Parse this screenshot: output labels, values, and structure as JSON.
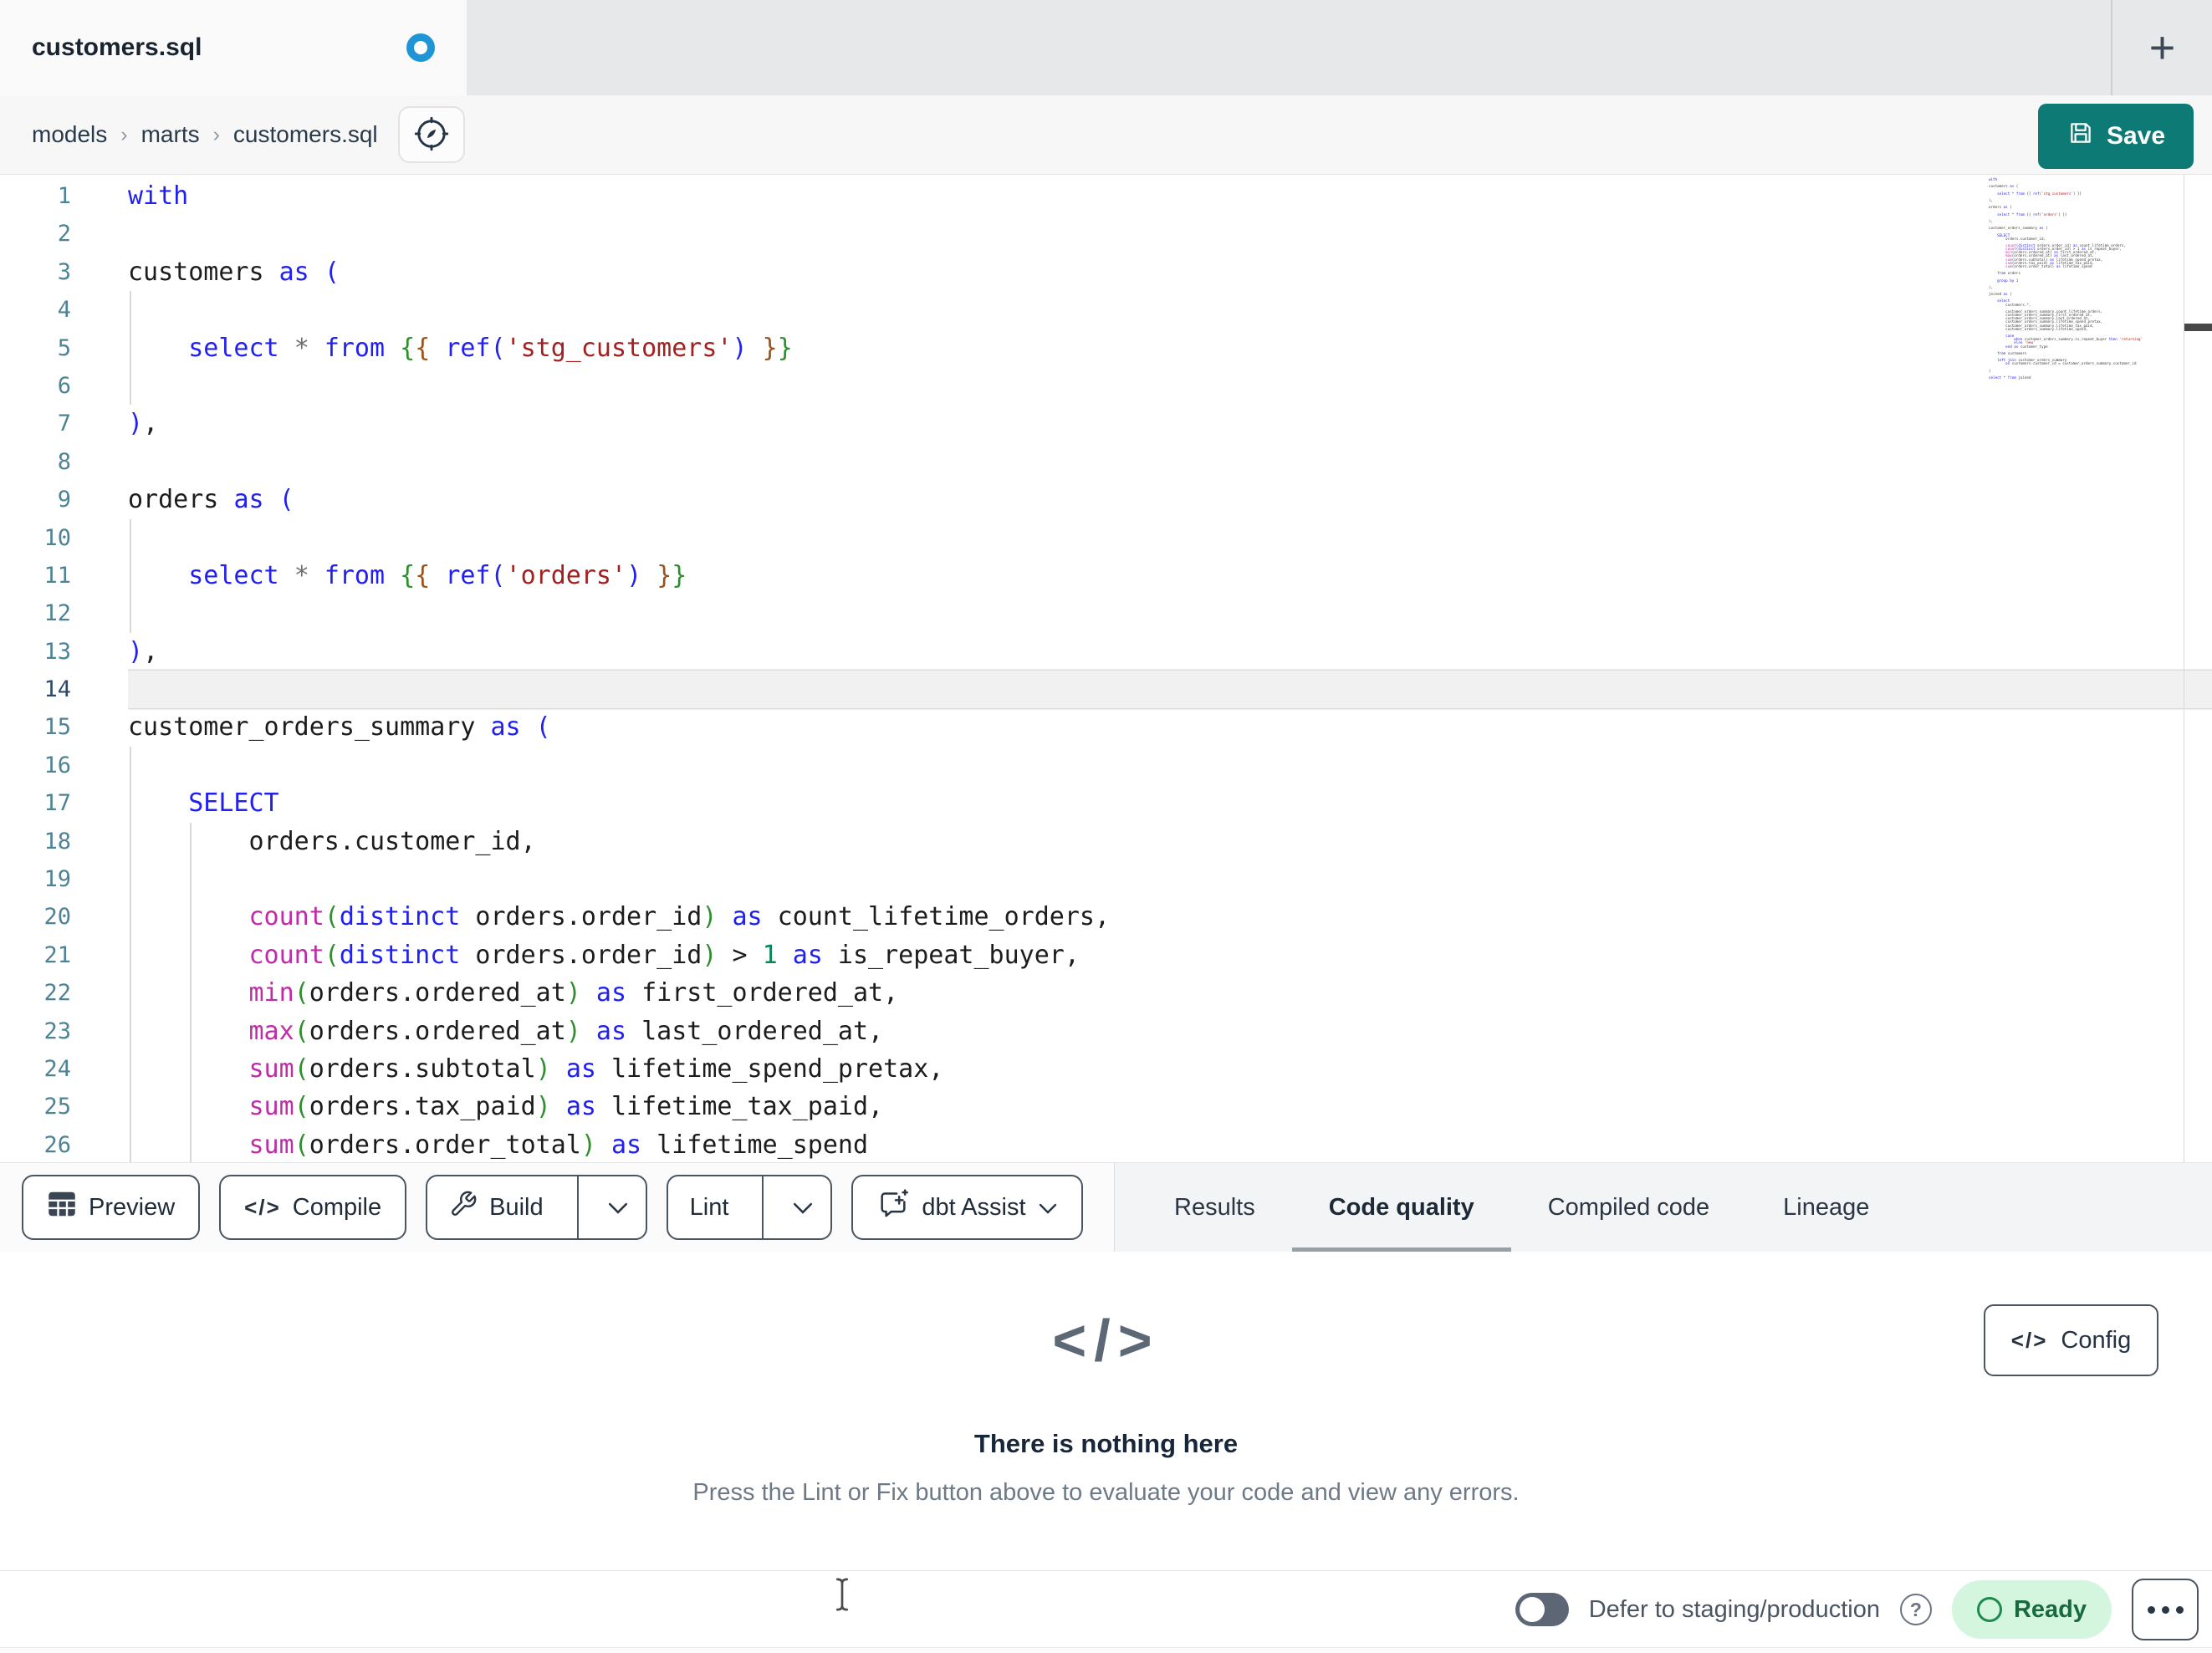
{
  "tab_bar": {
    "active_tab": "customers.sql",
    "new_tab_label": "+"
  },
  "breadcrumb": {
    "items": [
      "models",
      "marts",
      "customers.sql"
    ],
    "separator": "›"
  },
  "save": {
    "label": "Save"
  },
  "toolbar": {
    "preview": "Preview",
    "compile": "Compile",
    "build": "Build",
    "lint": "Lint",
    "dbt_assist": "dbt Assist",
    "compile_icon": "</>"
  },
  "result_tabs": [
    {
      "label": "Results",
      "active": false
    },
    {
      "label": "Code quality",
      "active": true
    },
    {
      "label": "Compiled code",
      "active": false
    },
    {
      "label": "Lineage",
      "active": false
    }
  ],
  "panel": {
    "empty_icon": "</>",
    "title": "There is nothing here",
    "description": "Press the Lint or Fix button above to evaluate your code and view any errors.",
    "config_label": "Config",
    "config_icon": "</>"
  },
  "footer": {
    "defer_label": "Defer to staging/production",
    "help_glyph": "?",
    "status": "Ready"
  },
  "colors": {
    "save_button": "#0e7a76",
    "modified_dot": "#2095d6",
    "ready_badge_bg": "#d5f6de",
    "ready_badge_text": "#186a3e",
    "keyword_blue": "#2121ef",
    "function_magenta": "#c02ca8",
    "string_red": "#a32020",
    "number_green": "#0a8658"
  },
  "editor": {
    "lines": [
      {
        "n": 1,
        "g": [],
        "a": false,
        "t": [
          [
            "kw",
            "with"
          ]
        ]
      },
      {
        "n": 2,
        "g": [],
        "a": false,
        "t": []
      },
      {
        "n": 3,
        "g": [],
        "a": false,
        "t": [
          [
            "pl",
            "customers "
          ],
          [
            "kw",
            "as"
          ],
          [
            "pl",
            " "
          ],
          [
            "pb",
            "("
          ]
        ]
      },
      {
        "n": 4,
        "g": [
          0
        ],
        "a": false,
        "t": []
      },
      {
        "n": 5,
        "g": [
          0
        ],
        "a": false,
        "t": [
          [
            "pl",
            "    "
          ],
          [
            "kw",
            "select"
          ],
          [
            "pl",
            " "
          ],
          [
            "op",
            "*"
          ],
          [
            "pl",
            " "
          ],
          [
            "kw",
            "from"
          ],
          [
            "pl",
            " "
          ],
          [
            "jo",
            "{"
          ],
          [
            "ji",
            "{"
          ],
          [
            "pl",
            " "
          ],
          [
            "kw",
            "ref"
          ],
          [
            "pb",
            "("
          ],
          [
            "str",
            "'stg_customers'"
          ],
          [
            "pb",
            ")"
          ],
          [
            "pl",
            " "
          ],
          [
            "ji",
            "}"
          ],
          [
            "jo",
            "}"
          ]
        ]
      },
      {
        "n": 6,
        "g": [
          0
        ],
        "a": false,
        "t": []
      },
      {
        "n": 7,
        "g": [],
        "a": false,
        "t": [
          [
            "pb",
            ")"
          ],
          [
            "pl",
            ","
          ]
        ]
      },
      {
        "n": 8,
        "g": [],
        "a": false,
        "t": []
      },
      {
        "n": 9,
        "g": [],
        "a": false,
        "t": [
          [
            "pl",
            "orders "
          ],
          [
            "kw",
            "as"
          ],
          [
            "pl",
            " "
          ],
          [
            "pb",
            "("
          ]
        ]
      },
      {
        "n": 10,
        "g": [
          0
        ],
        "a": false,
        "t": []
      },
      {
        "n": 11,
        "g": [
          0
        ],
        "a": false,
        "t": [
          [
            "pl",
            "    "
          ],
          [
            "kw",
            "select"
          ],
          [
            "pl",
            " "
          ],
          [
            "op",
            "*"
          ],
          [
            "pl",
            " "
          ],
          [
            "kw",
            "from"
          ],
          [
            "pl",
            " "
          ],
          [
            "jo",
            "{"
          ],
          [
            "ji",
            "{"
          ],
          [
            "pl",
            " "
          ],
          [
            "kw",
            "ref"
          ],
          [
            "pb",
            "("
          ],
          [
            "str",
            "'orders'"
          ],
          [
            "pb",
            ")"
          ],
          [
            "pl",
            " "
          ],
          [
            "ji",
            "}"
          ],
          [
            "jo",
            "}"
          ]
        ]
      },
      {
        "n": 12,
        "g": [
          0
        ],
        "a": false,
        "t": []
      },
      {
        "n": 13,
        "g": [],
        "a": false,
        "t": [
          [
            "pb",
            ")"
          ],
          [
            "pl",
            ","
          ]
        ]
      },
      {
        "n": 14,
        "g": [],
        "a": true,
        "t": []
      },
      {
        "n": 15,
        "g": [],
        "a": false,
        "t": [
          [
            "pl",
            "customer_orders_summary "
          ],
          [
            "kw",
            "as"
          ],
          [
            "pl",
            " "
          ],
          [
            "pb",
            "("
          ]
        ]
      },
      {
        "n": 16,
        "g": [
          0
        ],
        "a": false,
        "t": []
      },
      {
        "n": 17,
        "g": [
          0
        ],
        "a": false,
        "t": [
          [
            "pl",
            "    "
          ],
          [
            "kw",
            "SELECT"
          ]
        ]
      },
      {
        "n": 18,
        "g": [
          0,
          1
        ],
        "a": false,
        "t": [
          [
            "pl",
            "        orders.customer_id,"
          ]
        ]
      },
      {
        "n": 19,
        "g": [
          0,
          1
        ],
        "a": false,
        "t": []
      },
      {
        "n": 20,
        "g": [
          0,
          1
        ],
        "a": false,
        "t": [
          [
            "pl",
            "        "
          ],
          [
            "fn",
            "count"
          ],
          [
            "pg",
            "("
          ],
          [
            "kw",
            "distinct"
          ],
          [
            "pl",
            " orders.order_id"
          ],
          [
            "pg",
            ")"
          ],
          [
            "pl",
            " "
          ],
          [
            "kw",
            "as"
          ],
          [
            "pl",
            " count_lifetime_orders,"
          ]
        ]
      },
      {
        "n": 21,
        "g": [
          0,
          1
        ],
        "a": false,
        "t": [
          [
            "pl",
            "        "
          ],
          [
            "fn",
            "count"
          ],
          [
            "pg",
            "("
          ],
          [
            "kw",
            "distinct"
          ],
          [
            "pl",
            " orders.order_id"
          ],
          [
            "pg",
            ")"
          ],
          [
            "pl",
            " > "
          ],
          [
            "num",
            "1"
          ],
          [
            "pl",
            " "
          ],
          [
            "kw",
            "as"
          ],
          [
            "pl",
            " is_repeat_buyer,"
          ]
        ]
      },
      {
        "n": 22,
        "g": [
          0,
          1
        ],
        "a": false,
        "t": [
          [
            "pl",
            "        "
          ],
          [
            "fn",
            "min"
          ],
          [
            "pg",
            "("
          ],
          [
            "pl",
            "orders.ordered_at"
          ],
          [
            "pg",
            ")"
          ],
          [
            "pl",
            " "
          ],
          [
            "kw",
            "as"
          ],
          [
            "pl",
            " first_ordered_at,"
          ]
        ]
      },
      {
        "n": 23,
        "g": [
          0,
          1
        ],
        "a": false,
        "t": [
          [
            "pl",
            "        "
          ],
          [
            "fn",
            "max"
          ],
          [
            "pg",
            "("
          ],
          [
            "pl",
            "orders.ordered_at"
          ],
          [
            "pg",
            ")"
          ],
          [
            "pl",
            " "
          ],
          [
            "kw",
            "as"
          ],
          [
            "pl",
            " last_ordered_at,"
          ]
        ]
      },
      {
        "n": 24,
        "g": [
          0,
          1
        ],
        "a": false,
        "t": [
          [
            "pl",
            "        "
          ],
          [
            "fn",
            "sum"
          ],
          [
            "pg",
            "("
          ],
          [
            "pl",
            "orders.subtotal"
          ],
          [
            "pg",
            ")"
          ],
          [
            "pl",
            " "
          ],
          [
            "kw",
            "as"
          ],
          [
            "pl",
            " lifetime_spend_pretax,"
          ]
        ]
      },
      {
        "n": 25,
        "g": [
          0,
          1
        ],
        "a": false,
        "t": [
          [
            "pl",
            "        "
          ],
          [
            "fn",
            "sum"
          ],
          [
            "pg",
            "("
          ],
          [
            "pl",
            "orders.tax_paid"
          ],
          [
            "pg",
            ")"
          ],
          [
            "pl",
            " "
          ],
          [
            "kw",
            "as"
          ],
          [
            "pl",
            " lifetime_tax_paid,"
          ]
        ]
      },
      {
        "n": 26,
        "g": [
          0,
          1
        ],
        "a": false,
        "t": [
          [
            "pl",
            "        "
          ],
          [
            "fn",
            "sum"
          ],
          [
            "pg",
            "("
          ],
          [
            "pl",
            "orders.order_total"
          ],
          [
            "pg",
            ")"
          ],
          [
            "pl",
            " "
          ],
          [
            "kw",
            "as"
          ],
          [
            "pl",
            " lifetime_spend"
          ]
        ]
      }
    ],
    "minimap_lines": [
      "with",
      "",
      "customers as (",
      "",
      "    select * from {{ ref('stg_customers') }}",
      "",
      "),",
      "",
      "orders as (",
      "",
      "    select * from {{ ref('orders') }}",
      "",
      "),",
      "",
      "customer_orders_summary as (",
      "",
      "    SELECT",
      "        orders.customer_id,",
      "",
      "        count(distinct orders.order_id) as count_lifetime_orders,",
      "        count(distinct orders.order_id) > 1 as is_repeat_buyer,",
      "        min(orders.ordered_at) as first_ordered_at,",
      "        max(orders.ordered_at) as last_ordered_at,",
      "        sum(orders.subtotal) as lifetime_spend_pretax,",
      "        sum(orders.tax_paid) as lifetime_tax_paid,",
      "        sum(orders.order_total) as lifetime_spend",
      "",
      "    from orders",
      "",
      "    group by 1",
      "",
      "),",
      "",
      "joined as (",
      "",
      "    select",
      "        customers.*,",
      "",
      "        customer_orders_summary.count_lifetime_orders,",
      "        customer_orders_summary.first_ordered_at,",
      "        customer_orders_summary.last_ordered_at,",
      "        customer_orders_summary.lifetime_spend_pretax,",
      "        customer_orders_summary.lifetime_tax_paid,",
      "        customer_orders_summary.lifetime_spend,",
      "",
      "        case",
      "            when customer_orders_summary.is_repeat_buyer then 'returning'",
      "            else 'new'",
      "        end as customer_type",
      "",
      "    from customers",
      "",
      "    left join customer_orders_summary",
      "        on customers.customer_id = customer_orders_summary.customer_id",
      "",
      ")",
      "",
      "select * from joined"
    ]
  }
}
